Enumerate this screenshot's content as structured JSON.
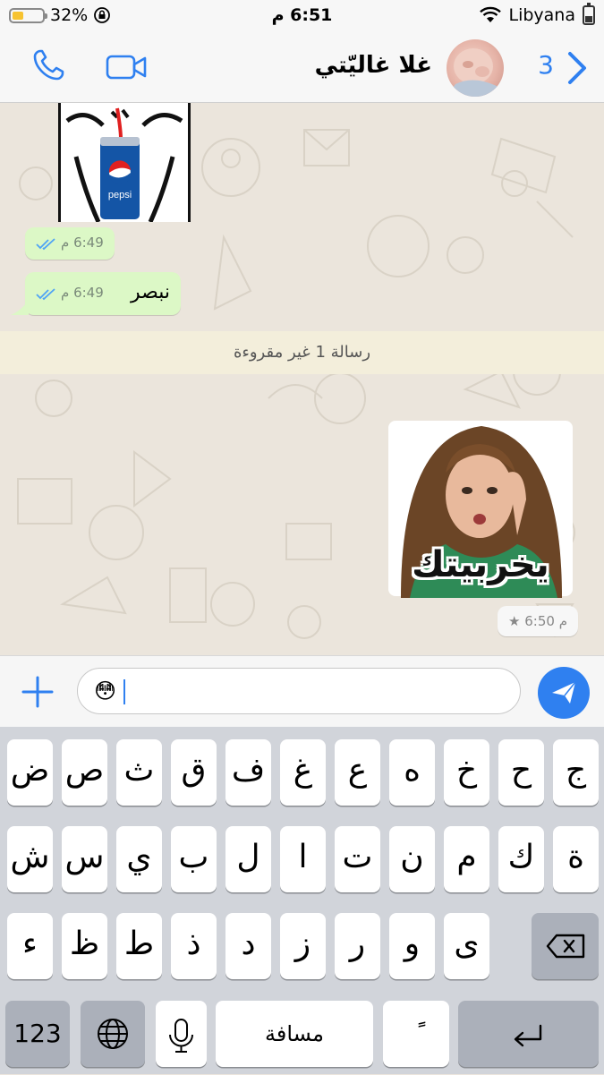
{
  "status_bar": {
    "battery_percent": "32%",
    "battery_level": 0.32,
    "battery_color": "#f7c330",
    "time": "6:51 م",
    "carrier": "Libyana",
    "icons": [
      "battery-icon",
      "orientation-lock-icon",
      "wifi-icon",
      "battery-vertical-icon"
    ]
  },
  "header": {
    "back_count": "3",
    "contact_name": "غلا غاليّتي",
    "accent_color": "#2f80f0",
    "icons": [
      "back-chevron-icon",
      "phone-icon",
      "video-call-icon",
      "avatar"
    ]
  },
  "messages": [
    {
      "type": "sticker",
      "sticker_text": "pepsi",
      "time": "6:49 م",
      "status": "read"
    },
    {
      "type": "text",
      "text": "نبصر",
      "time": "6:49 م",
      "status": "read"
    }
  ],
  "unread_banner": "رسالة 1 غير مقروءة",
  "incoming": {
    "sticker_text": "يخربيتك",
    "time": "6:50 م",
    "starred": true
  },
  "composer": {
    "value": "😳",
    "icons": [
      "plus-icon",
      "send-icon"
    ]
  },
  "keyboard": {
    "row1": [
      "ج",
      "ح",
      "خ",
      "ه",
      "ع",
      "غ",
      "ف",
      "ق",
      "ث",
      "ص",
      "ض"
    ],
    "row2": [
      "ة",
      "ك",
      "م",
      "ن",
      "ت",
      "ا",
      "ل",
      "ب",
      "ي",
      "س",
      "ش"
    ],
    "row3": [
      "ى",
      "و",
      "ر",
      "ز",
      "د",
      "ذ",
      "ط",
      "ظ",
      "ء"
    ],
    "numbers_label": "123",
    "space_label": "مسافة",
    "diacritic_label": "ًً"
  }
}
